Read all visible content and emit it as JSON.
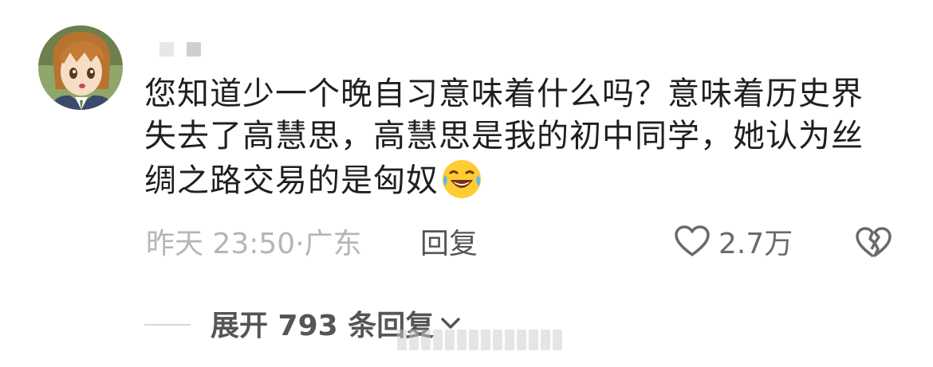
{
  "comment": {
    "text": "您知道少一个晚自习意味着什么吗？意味着历史界失去了高慧思，高慧思是我的初中同学，她认为丝绸之路交易的是匈奴",
    "emoji": "laughing-crying-face-emoji"
  },
  "meta": {
    "time_location": "昨天 23:50·广东",
    "reply_label": "回复",
    "like_count": "2.7万"
  },
  "expand": {
    "label": "展开 793 条回复"
  },
  "icons": {
    "like": "heart-icon",
    "dislike": "broken-heart-icon",
    "expand": "chevron-down-icon"
  },
  "colors": {
    "text": "#1f1f1f",
    "meta": "#b5b5b5",
    "action": "#555555"
  }
}
